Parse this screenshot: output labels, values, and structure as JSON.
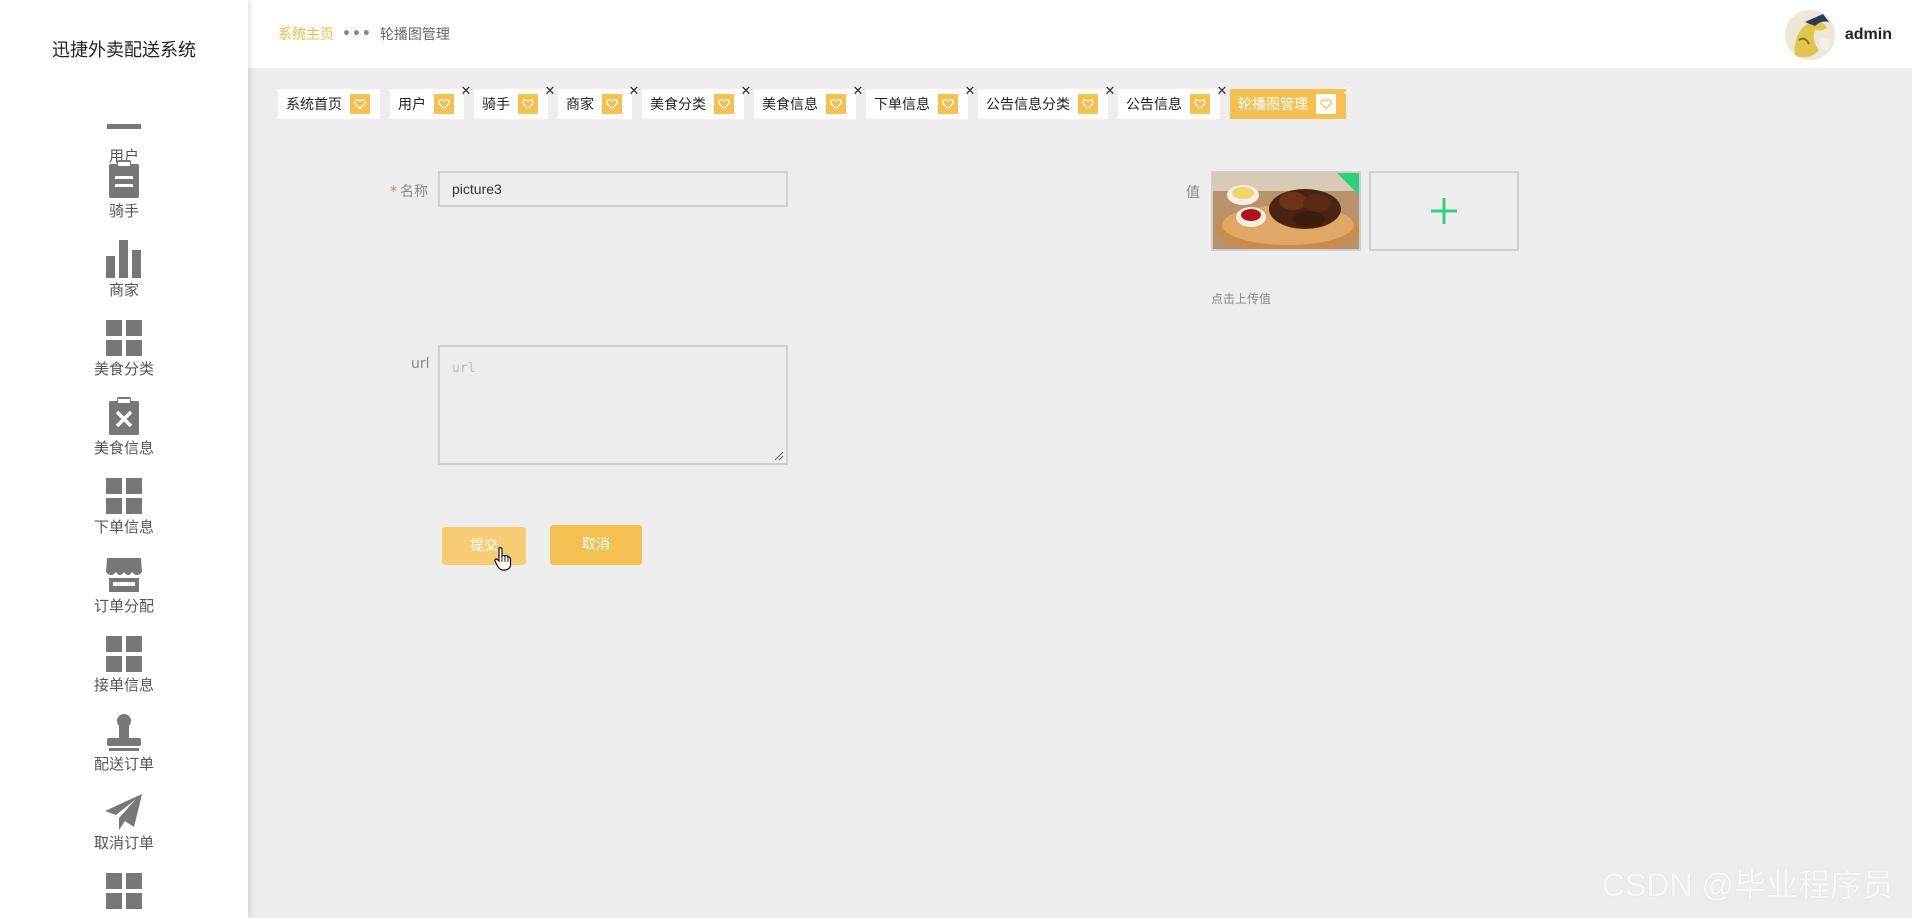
{
  "app": {
    "title": "迅捷外卖配送系统"
  },
  "sidebar": {
    "items": [
      {
        "label": "用户",
        "icon": "user-icon"
      },
      {
        "label": "骑手",
        "icon": "clipboard-icon"
      },
      {
        "label": "商家",
        "icon": "bar-chart-icon"
      },
      {
        "label": "美食分类",
        "icon": "grid-icon"
      },
      {
        "label": "美食信息",
        "icon": "clipboard-x-icon"
      },
      {
        "label": "下单信息",
        "icon": "grid-icon"
      },
      {
        "label": "订单分配",
        "icon": "store-icon"
      },
      {
        "label": "接单信息",
        "icon": "grid-icon"
      },
      {
        "label": "配送订单",
        "icon": "stamp-icon"
      },
      {
        "label": "取消订单",
        "icon": "paper-plane-icon"
      },
      {
        "label": "",
        "icon": "grid-icon"
      }
    ]
  },
  "header": {
    "breadcrumb": {
      "home": "系统主页",
      "separator": "•••",
      "current": "轮播图管理"
    },
    "user": {
      "name": "admin"
    }
  },
  "tabs": [
    {
      "label": "系统首页",
      "closable": false,
      "active": false
    },
    {
      "label": "用户",
      "closable": true,
      "active": false
    },
    {
      "label": "骑手",
      "closable": true,
      "active": false
    },
    {
      "label": "商家",
      "closable": true,
      "active": false
    },
    {
      "label": "美食分类",
      "closable": true,
      "active": false
    },
    {
      "label": "美食信息",
      "closable": true,
      "active": false
    },
    {
      "label": "下单信息",
      "closable": true,
      "active": false
    },
    {
      "label": "公告信息分类",
      "closable": true,
      "active": false
    },
    {
      "label": "公告信息",
      "closable": true,
      "active": false
    },
    {
      "label": "轮播图管理",
      "closable": true,
      "active": true
    }
  ],
  "form": {
    "name": {
      "label": "名称",
      "required_mark": "*",
      "value": "picture3"
    },
    "url": {
      "label": "url",
      "placeholder": "url"
    },
    "value": {
      "label": "值",
      "upload_tip": "点击上传值"
    },
    "submit_label": "提交",
    "cancel_label": "取消"
  },
  "watermark": "CSDN @毕业程序员",
  "colors": {
    "accent": "#f5c052",
    "add_icon": "#2ed17a"
  }
}
